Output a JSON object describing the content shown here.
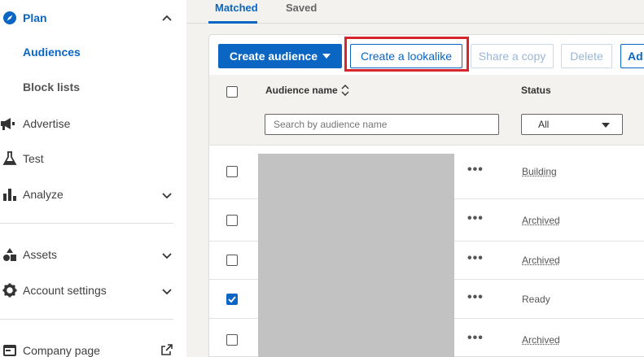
{
  "sidebar": {
    "plan": "Plan",
    "audiences": "Audiences",
    "block_lists": "Block lists",
    "advertise": "Advertise",
    "test": "Test",
    "analyze": "Analyze",
    "assets": "Assets",
    "account_settings": "Account settings",
    "company_page": "Company page"
  },
  "tabs": {
    "matched": "Matched",
    "saved": "Saved"
  },
  "toolbar": {
    "create_audience": "Create audience",
    "create_lookalike": "Create a lookalike",
    "share_copy": "Share a copy",
    "delete": "Delete",
    "add": "Ad"
  },
  "table": {
    "col_name": "Audience name",
    "col_status": "Status",
    "search_placeholder": "Search by audience name",
    "status_filter": "All",
    "rows": [
      {
        "status": "Building",
        "checked": false
      },
      {
        "status": "Archived",
        "checked": false
      },
      {
        "status": "Archived",
        "checked": false
      },
      {
        "status": "Ready",
        "checked": true
      },
      {
        "status": "Archived",
        "checked": false
      }
    ],
    "more_glyph": "•••"
  },
  "colors": {
    "accent": "#0a66c2",
    "highlight": "#d7262b",
    "redaction": "#c2c2c2"
  }
}
